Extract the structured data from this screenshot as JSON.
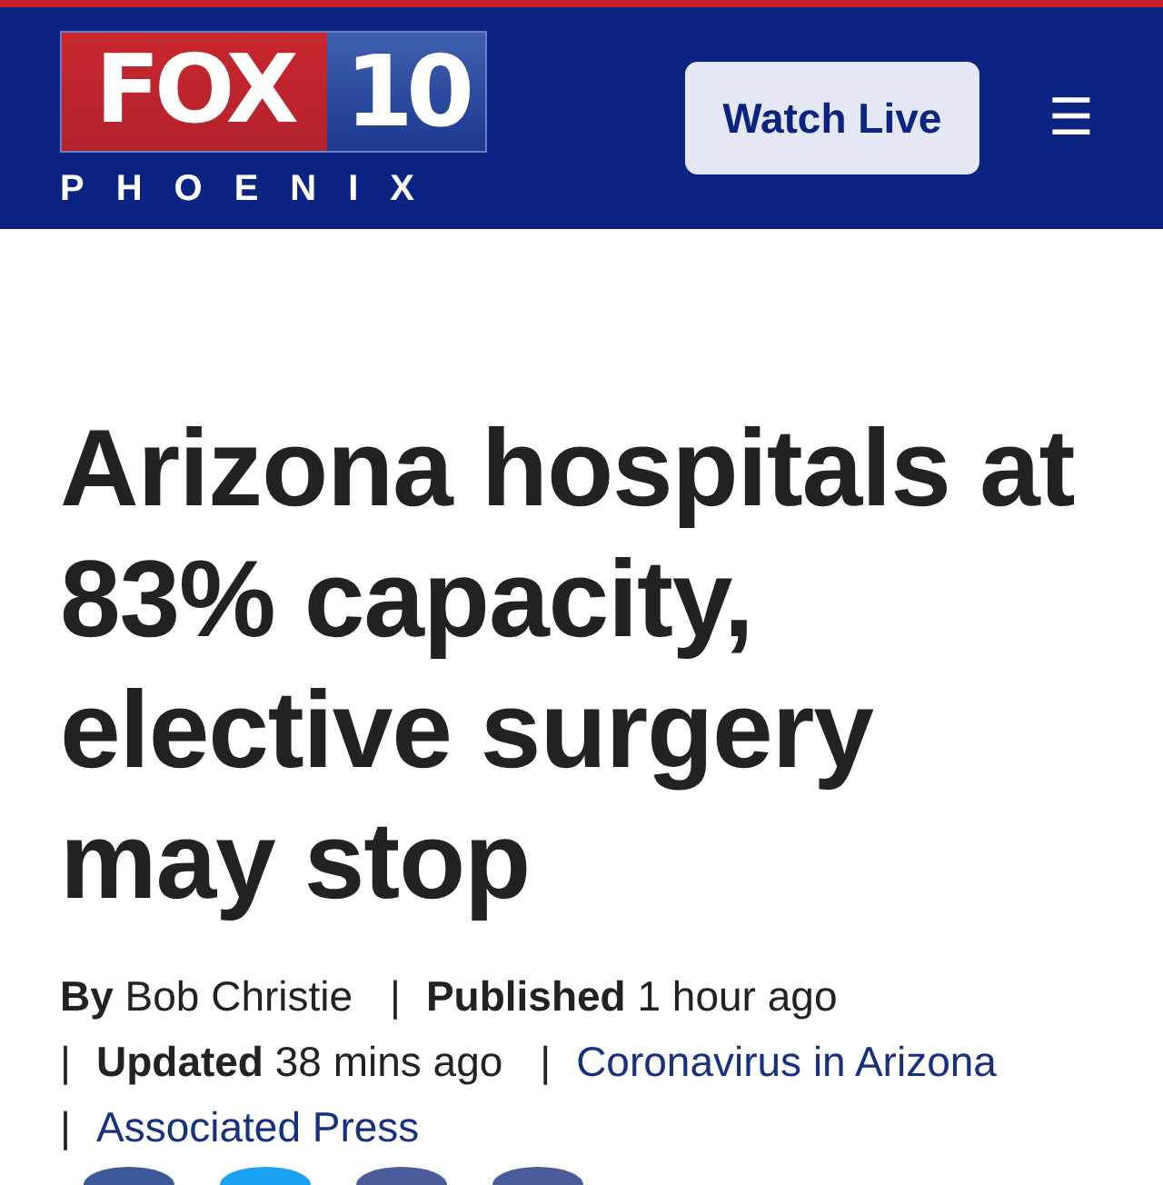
{
  "header": {
    "logo": {
      "brand": "FOX",
      "channel": "10",
      "city": "PHOENIX"
    },
    "watch_button": "Watch Live",
    "menu_icon": "☰"
  },
  "article": {
    "headline": "Arizona hospitals at 83% capacity, elective surgery may stop",
    "meta": [
      {
        "kind": "labeled",
        "label": "By",
        "value": "Bob Christie"
      },
      {
        "kind": "labeled",
        "separator": "|",
        "label": "Published",
        "value": "1 hour ago"
      },
      {
        "kind": "labeled",
        "separator": "|",
        "label": "Updated",
        "value": "38 mins ago"
      },
      {
        "kind": "link",
        "separator": "|",
        "text": "Coronavirus in Arizona"
      },
      {
        "kind": "link",
        "separator": "|",
        "text": "Associated Press"
      }
    ],
    "share_buttons": [
      {
        "color": "#3b5998"
      },
      {
        "color": "#1da1f2"
      },
      {
        "color": "#4a5d9a"
      },
      {
        "color": "#4a5d9a"
      }
    ]
  }
}
